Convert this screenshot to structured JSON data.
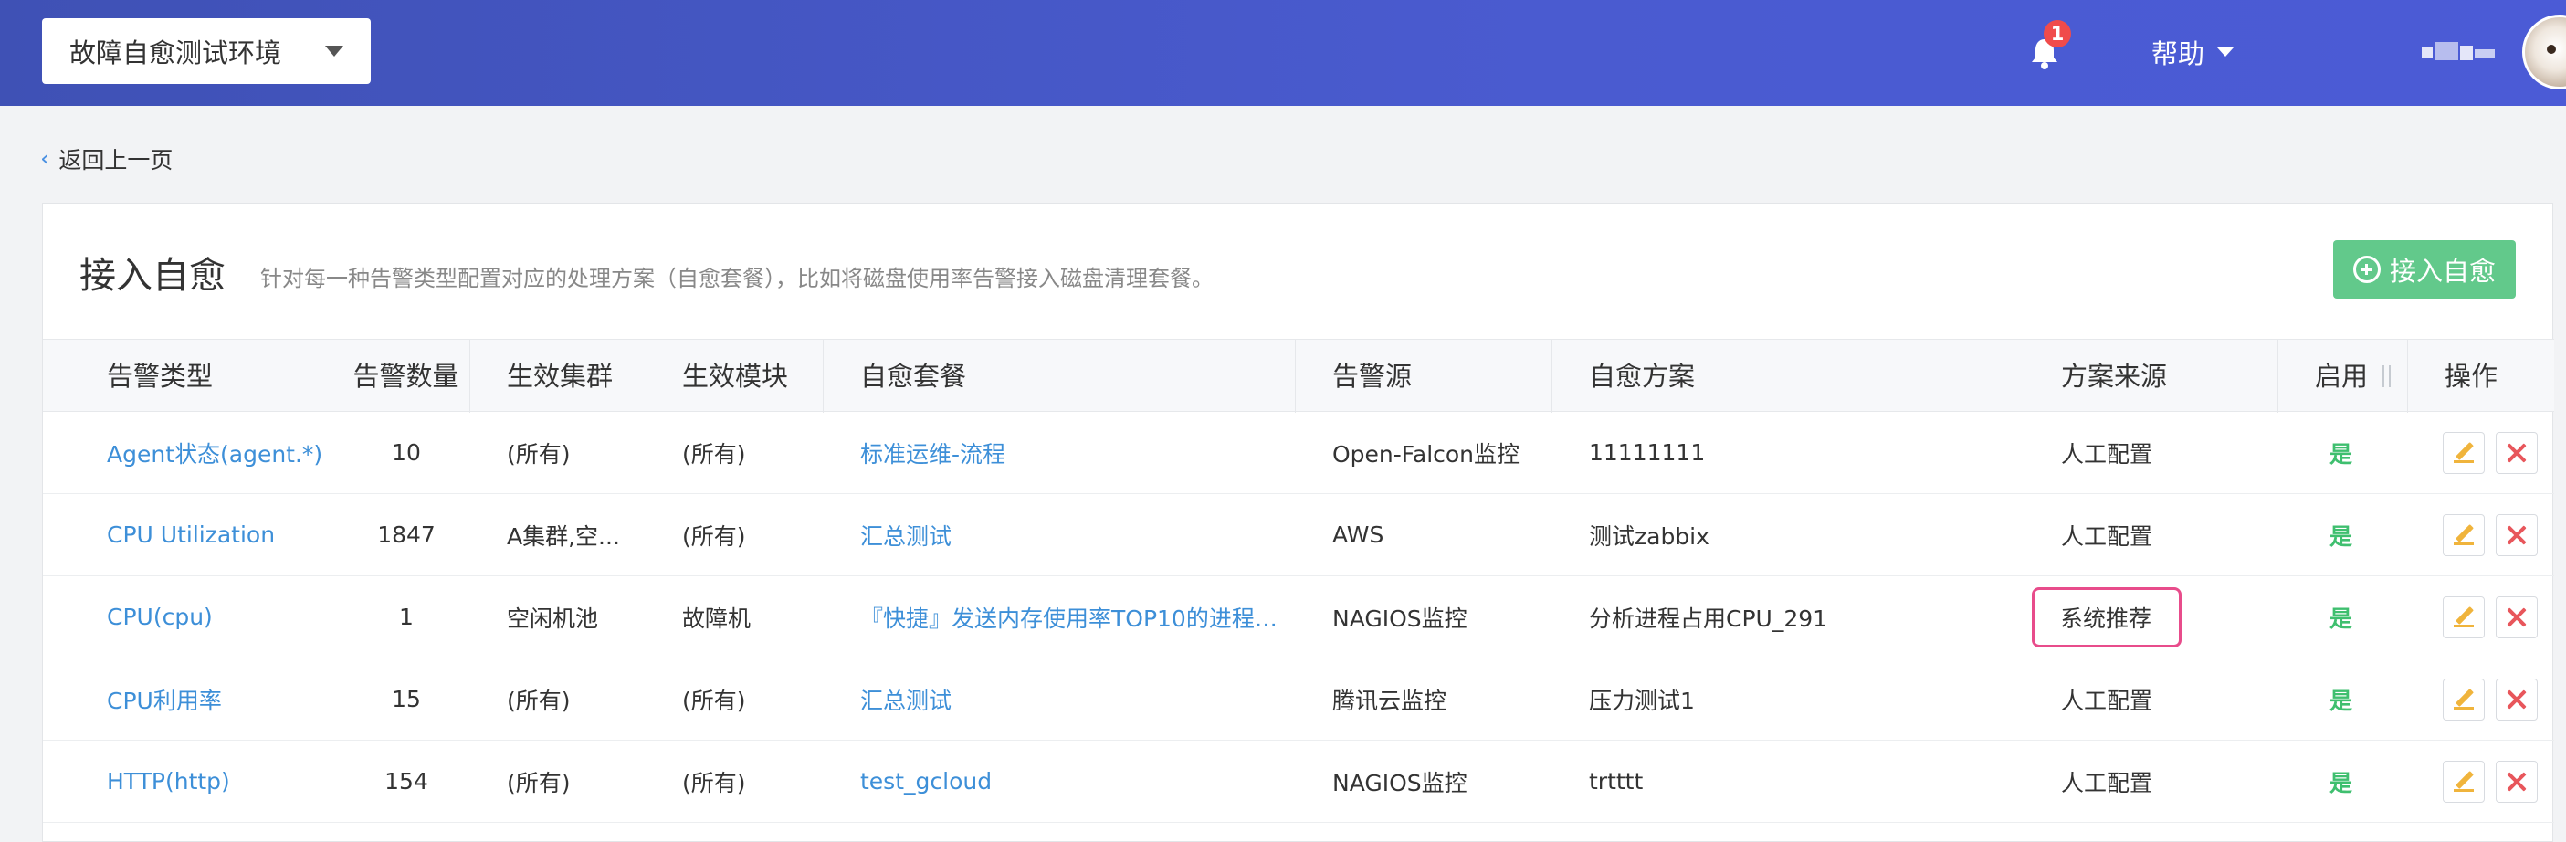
{
  "header": {
    "env_select": "故障自愈测试环境",
    "notification_count": "1",
    "help_label": "帮助",
    "colors": {
      "bar": "#4a5bd0",
      "badge": "#f04b4b"
    },
    "icons": {
      "bell": "bell-icon",
      "caret": "caret-down-icon",
      "avatar": "avatar"
    }
  },
  "back_link": "返回上一页",
  "card": {
    "title": "接入自愈",
    "description": "针对每一种告警类型配置对应的处理方案（自愈套餐），比如将磁盘使用率告警接入磁盘清理套餐。",
    "add_button": "接入自愈"
  },
  "table": {
    "columns": [
      "告警类型",
      "告警数量",
      "生效集群",
      "生效模块",
      "自愈套餐",
      "告警源",
      "自愈方案",
      "方案来源",
      "启用",
      "操作"
    ],
    "rows": [
      {
        "alarm_type": "Agent状态(agent.*)",
        "count": "10",
        "cluster": "(所有)",
        "module": "(所有)",
        "package": "标准运维-流程",
        "source": "Open-Falcon监控",
        "plan": "11111111",
        "origin": "人工配置",
        "enabled": "是"
      },
      {
        "alarm_type": "CPU Utilization",
        "count": "1847",
        "cluster": "A集群,空...",
        "module": "(所有)",
        "package": "汇总测试",
        "source": "AWS",
        "plan": "测试zabbix",
        "origin": "人工配置",
        "enabled": "是"
      },
      {
        "alarm_type": "CPU(cpu)",
        "count": "1",
        "cluster": "空闲机池",
        "module": "故障机",
        "package": "『快捷』发送内存使用率TOP10的进程（...",
        "source": "NAGIOS监控",
        "plan": "分析进程占用CPU_291",
        "origin": "系统推荐",
        "enabled": "是"
      },
      {
        "alarm_type": "CPU利用率",
        "count": "15",
        "cluster": "(所有)",
        "module": "(所有)",
        "package": "汇总测试",
        "source": "腾讯云监控",
        "plan": "压力测试1",
        "origin": "人工配置",
        "enabled": "是"
      },
      {
        "alarm_type": "HTTP(http)",
        "count": "154",
        "cluster": "(所有)",
        "module": "(所有)",
        "package": "test_gcloud",
        "source": "NAGIOS监控",
        "plan": "trtttt",
        "origin": "人工配置",
        "enabled": "是"
      }
    ],
    "highlighted_cell_color": "#e84c8b"
  }
}
